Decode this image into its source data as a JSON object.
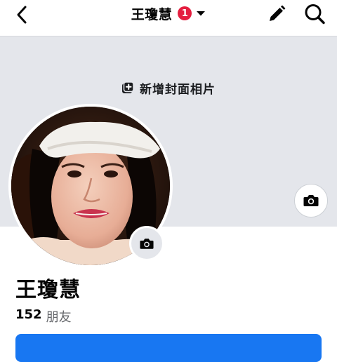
{
  "header": {
    "title": "王瓊慧",
    "notification_count": "1"
  },
  "cover": {
    "add_cover_label": "新增封面相片"
  },
  "profile": {
    "name": "王瓊慧",
    "friends_count": "152",
    "friends_label": "朋友"
  },
  "icons": {
    "back": "chevron-left-icon",
    "dropdown": "caret-down-icon",
    "edit": "pencil-icon",
    "search": "search-icon",
    "add_cover": "add-photo-icon",
    "camera": "camera-icon"
  },
  "colors": {
    "accent": "#1877f2",
    "badge": "#e41e3f",
    "cover_bg": "#e4e6eb"
  }
}
